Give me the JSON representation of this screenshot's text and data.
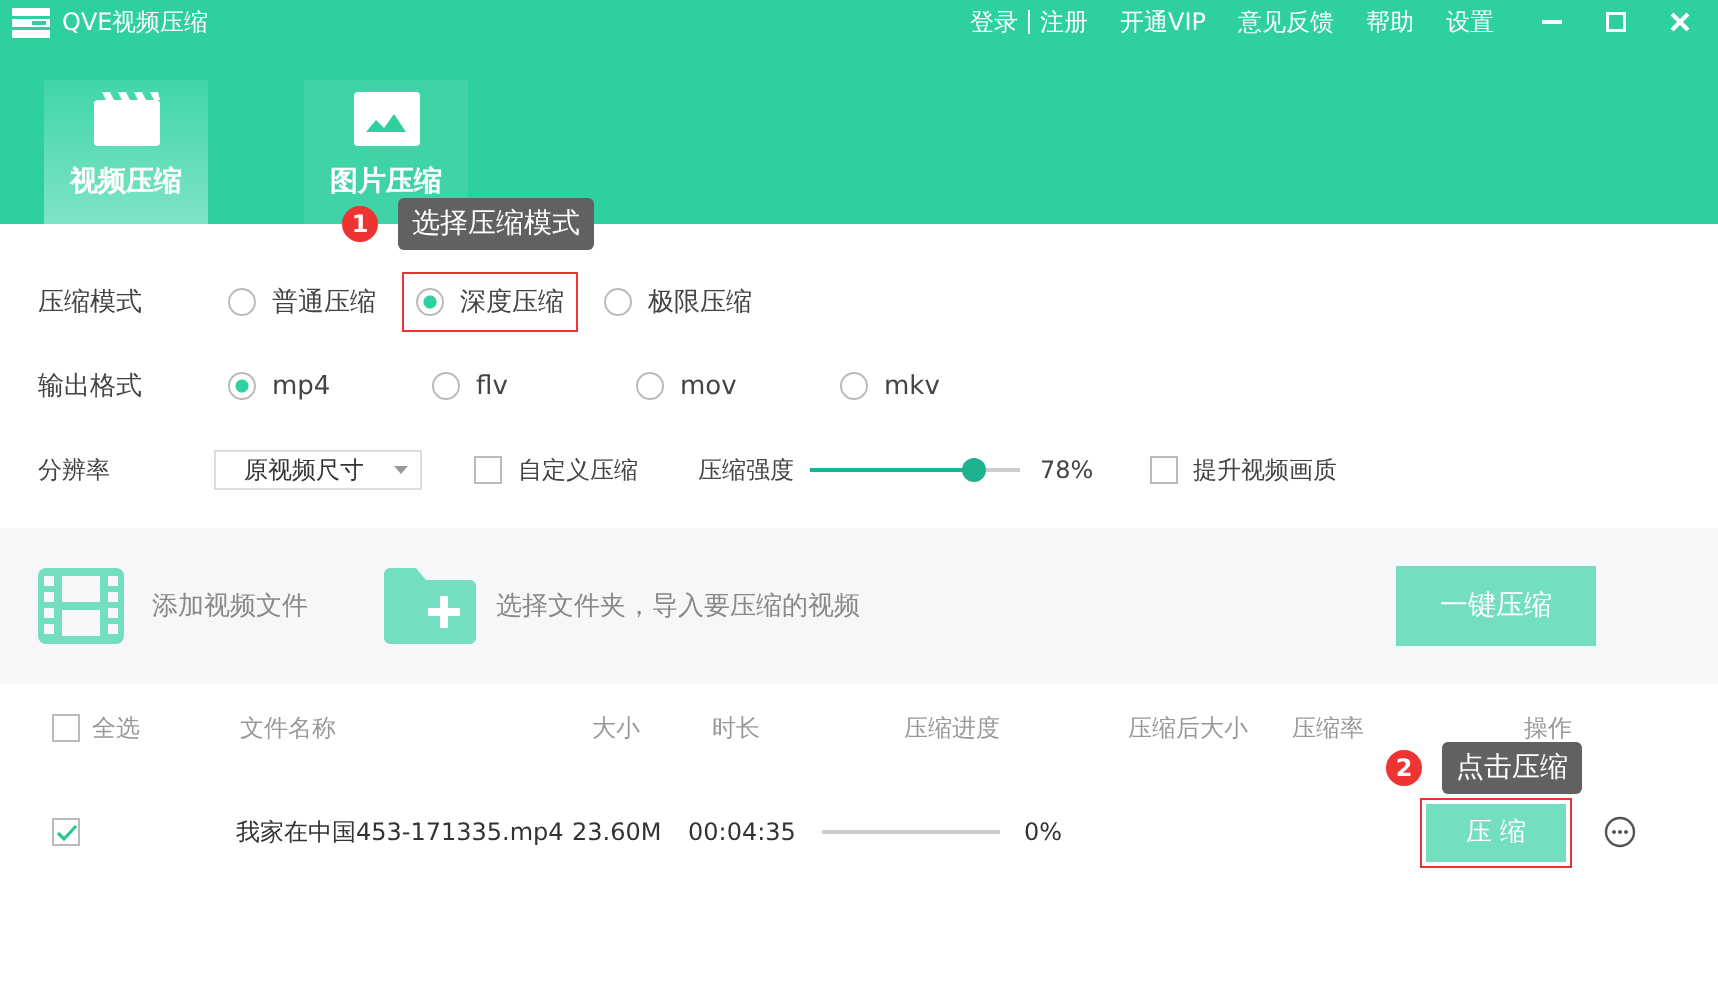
{
  "window": {
    "title": "QVE视频压缩"
  },
  "account_links": [
    "登录",
    "注册"
  ],
  "top_links": [
    "开通VIP",
    "意见反馈",
    "帮助",
    "设置"
  ],
  "mode_tabs": [
    {
      "label": "视频压缩",
      "selected": true
    },
    {
      "label": "图片压缩",
      "selected": false
    }
  ],
  "settings": {
    "compress_mode": {
      "label": "压缩模式",
      "options": [
        {
          "label": "普通压缩",
          "selected": false,
          "highlighted": false
        },
        {
          "label": "深度压缩",
          "selected": true,
          "highlighted": true
        },
        {
          "label": "极限压缩",
          "selected": false,
          "highlighted": false
        }
      ]
    },
    "output_format": {
      "label": "输出格式",
      "options": [
        {
          "label": "mp4",
          "selected": true
        },
        {
          "label": "flv",
          "selected": false
        },
        {
          "label": "mov",
          "selected": false
        },
        {
          "label": "mkv",
          "selected": false
        }
      ]
    },
    "resolution": {
      "label": "分辨率",
      "value": "原视频尺寸"
    },
    "custom": {
      "label": "自定义压缩",
      "checked": false
    },
    "strength": {
      "label": "压缩强度",
      "level": 0.78,
      "reading": "78%"
    },
    "enhance": {
      "label": "提升视频画质",
      "checked": false
    }
  },
  "toolbar": {
    "add_file": "添加视频文件",
    "add_folder": "选择文件夹，导入要压缩的视频",
    "compress_all": "一键压缩"
  },
  "table": {
    "select_all": {
      "label": "全选",
      "checked": false
    },
    "columns": [
      "文件名称",
      "大小",
      "时长",
      "压缩进度",
      "压缩后大小",
      "压缩率",
      "操作"
    ],
    "rows": [
      {
        "checked": true,
        "name": "我家在中国453-171335.mp4",
        "size": "23.60M",
        "duration": "00:04:35",
        "level": 0,
        "progress": "0%",
        "action": "压 缩",
        "highlighted": true
      }
    ]
  },
  "guide_steps": [
    {
      "number": "1",
      "text": "选择压缩模式"
    },
    {
      "number": "2",
      "text": "点击压缩"
    }
  ]
}
